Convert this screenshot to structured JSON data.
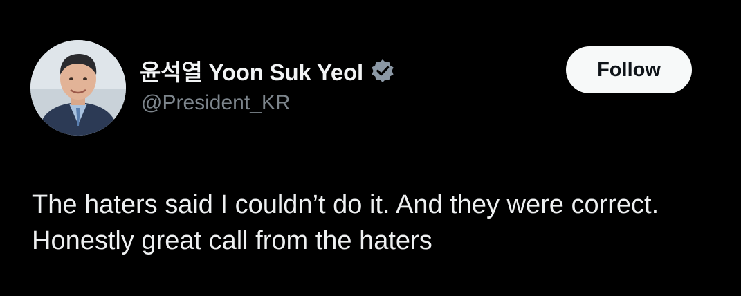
{
  "author": {
    "display_name": "윤석열 Yoon Suk Yeol",
    "handle": "@President_KR",
    "verified_icon": "verified-badge-icon"
  },
  "actions": {
    "follow_label": "Follow"
  },
  "tweet": {
    "text": "The haters said I couldn’t do it. And they were correct. Honestly great call from the haters"
  },
  "colors": {
    "background": "#000000",
    "handle_gray": "#7d858c",
    "verified_badge": "#8b98a5",
    "button_bg": "#f7f9f9"
  }
}
